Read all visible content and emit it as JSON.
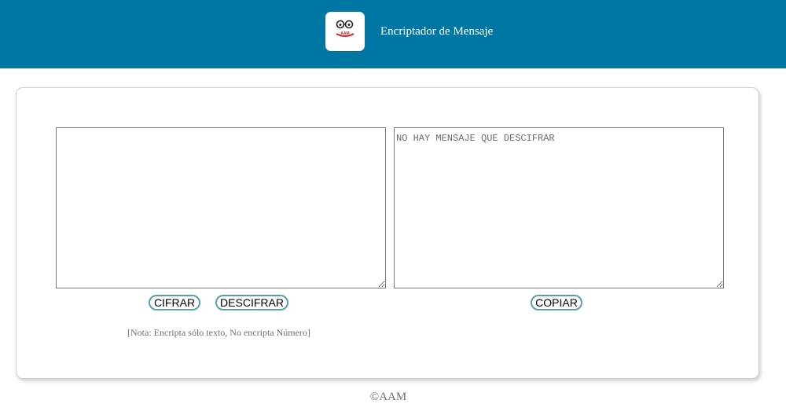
{
  "header": {
    "title": "Encriptador de Mensaje",
    "logo_text": "AAM",
    "background": "#0077a3"
  },
  "main": {
    "input": {
      "value": "",
      "placeholder": ""
    },
    "output": {
      "value": "",
      "placeholder": "NO HAY MENSAJE QUE DESCIFRAR"
    },
    "buttons": {
      "encrypt_label": "CIFRAR",
      "decrypt_label": "DESCIFRAR",
      "copy_label": "COPIAR"
    },
    "note": "[Nota: Encripta sólo texto, No encripta Número]"
  },
  "footer": {
    "copyright": "©AAM"
  },
  "colors": {
    "button_border": "#5aa0a8",
    "note_text": "#6e6e6e"
  }
}
